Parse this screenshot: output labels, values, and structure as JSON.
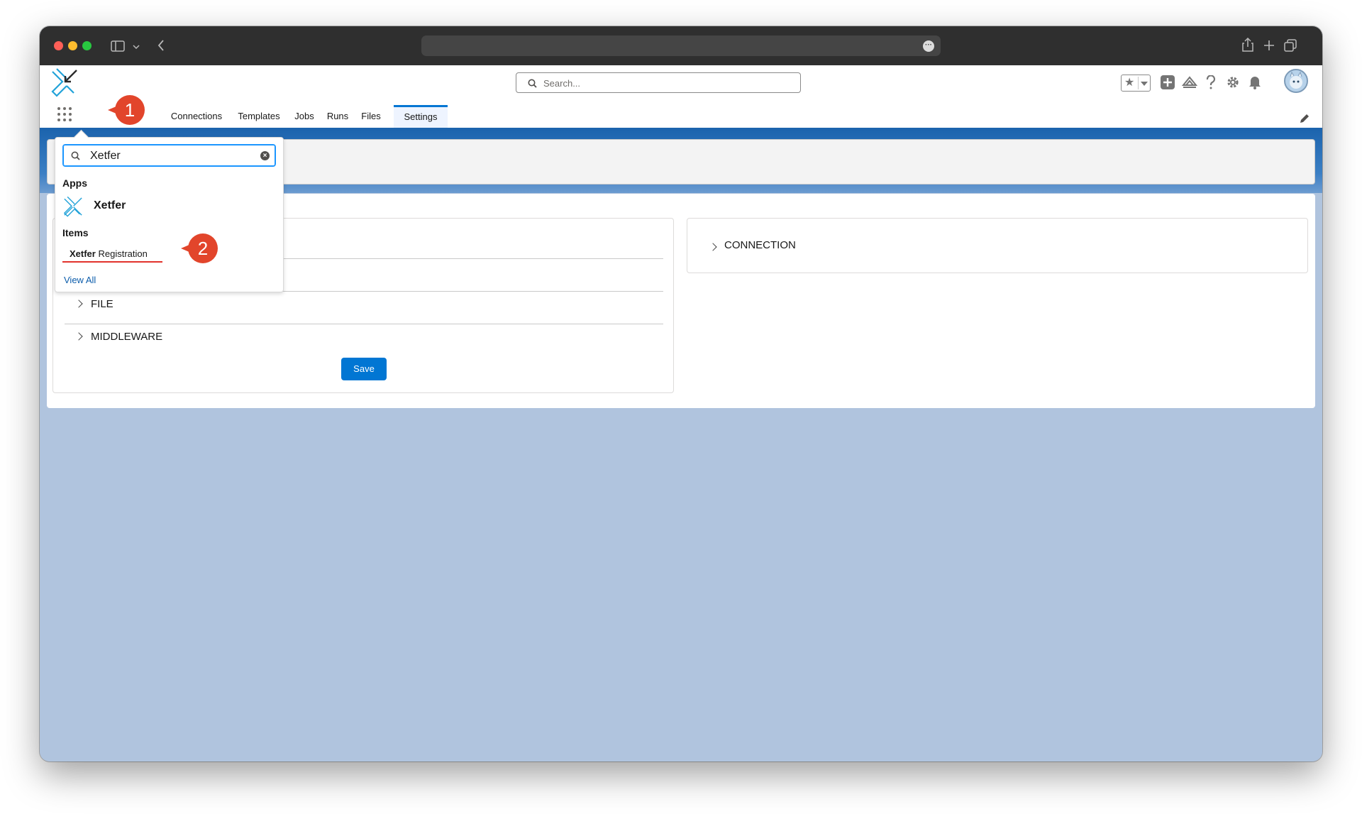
{
  "browser": {
    "url": "",
    "icons": [
      "sidebar-toggle-icon",
      "chevron-down-icon",
      "back-icon",
      "share-icon",
      "new-tab-icon",
      "tabs-overview-icon"
    ]
  },
  "header": {
    "search_placeholder": "Search...",
    "icons": [
      "favorites-star-icon",
      "global-actions-icon",
      "trailhead-icon",
      "help-icon",
      "setup-gear-icon",
      "notifications-bell-icon",
      "avatar"
    ]
  },
  "nav": {
    "items": [
      {
        "label": "Connections"
      },
      {
        "label": "Templates"
      },
      {
        "label": "Jobs"
      },
      {
        "label": "Runs"
      },
      {
        "label": "Files"
      },
      {
        "label": "Settings",
        "active": true
      }
    ]
  },
  "launcher": {
    "search_value": "Xetfer",
    "apps_heading": "Apps",
    "app_name": "Xetfer",
    "items_heading": "Items",
    "item_bold": "Xetfer",
    "item_rest": "Registration",
    "view_all": "View All"
  },
  "settings": {
    "left_sections": [
      "FILE",
      "MIDDLEWARE"
    ],
    "save_label": "Save",
    "right_sections": [
      "CONNECTION"
    ]
  },
  "callouts": {
    "one": "1",
    "two": "2"
  },
  "colors": {
    "accent": "#0176d3",
    "callout": "#e2452b",
    "page_background": "#b0c4de"
  }
}
